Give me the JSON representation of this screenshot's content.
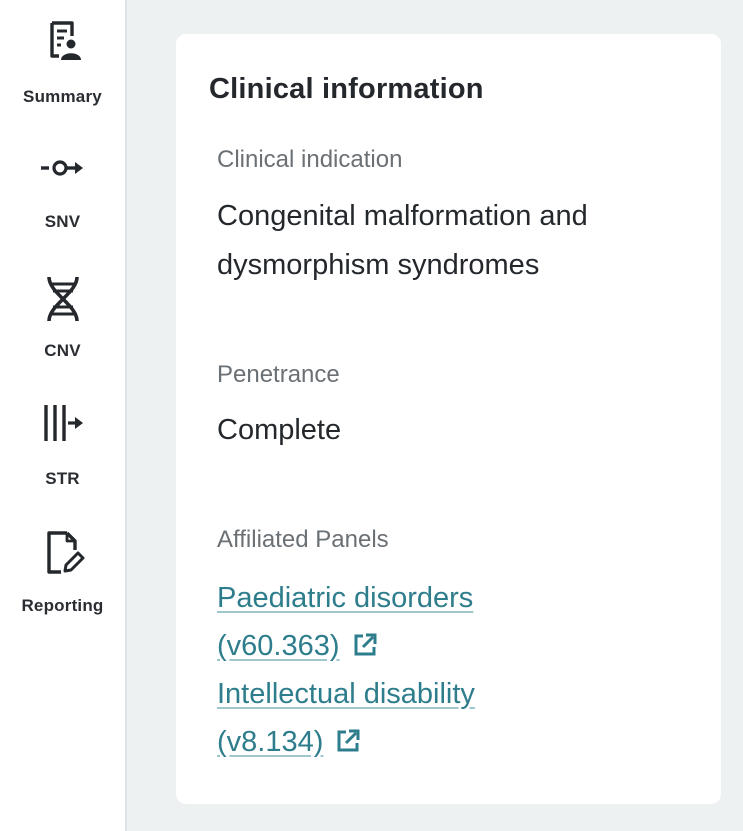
{
  "sidebar": {
    "items": [
      {
        "label": "Summary",
        "icon": "summary-icon"
      },
      {
        "label": "SNV",
        "icon": "snv-icon"
      },
      {
        "label": "CNV",
        "icon": "dna-icon"
      },
      {
        "label": "STR",
        "icon": "str-icon"
      },
      {
        "label": "Reporting",
        "icon": "reporting-icon"
      }
    ]
  },
  "card": {
    "title": "Clinical information",
    "clinical_indication": {
      "label": "Clinical indication",
      "value": "Congenital malformation and dysmorphism syndromes"
    },
    "penetrance": {
      "label": "Penetrance",
      "value": "Complete"
    },
    "affiliated_panels": {
      "label": "Affiliated Panels",
      "panels": [
        {
          "text": "Paediatric disorders (v60.363)",
          "icon": "external-link-icon"
        },
        {
          "text": "Intellectual disability (v8.134)",
          "icon": "external-link-icon"
        }
      ]
    }
  },
  "colors": {
    "link": "#2e7d8c",
    "background": "#eef1f2",
    "card": "#ffffff"
  }
}
